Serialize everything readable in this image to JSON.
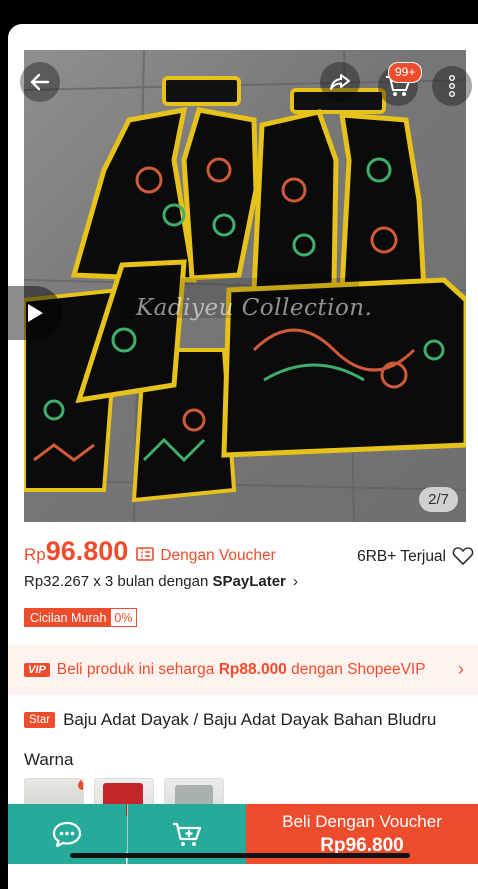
{
  "gallery": {
    "watermark": "Kadiyeu Collection.",
    "counter": "2/7"
  },
  "header": {
    "cart_badge": "99+"
  },
  "price": {
    "currency": "Rp",
    "amount": "96.800",
    "voucher_label": "Dengan Voucher",
    "sold": "6RB+ Terjual"
  },
  "paylater": {
    "text": "Rp32.267 x 3 bulan dengan ",
    "brand": "SPayLater",
    "chevron": "›"
  },
  "cicilan": {
    "label": "Cicilan Murah",
    "percent": "0%"
  },
  "vip": {
    "badge": "VIP",
    "text_before": "Beli produk ini seharga ",
    "price": "Rp88.000",
    "text_after": " dengan ShopeeVIP",
    "chevron": "›"
  },
  "product": {
    "badge": "Star",
    "title": "Baju Adat Dayak / Baju Adat Dayak Bahan Bludru"
  },
  "variant": {
    "label": "Warna"
  },
  "bottom_bar": {
    "buy_label": "Beli Dengan Voucher",
    "buy_price": "Rp96.800"
  },
  "colors": {
    "brand_orange": "#ee4d2d",
    "teal": "#26aa99",
    "vip_bg": "#fff3ef"
  }
}
